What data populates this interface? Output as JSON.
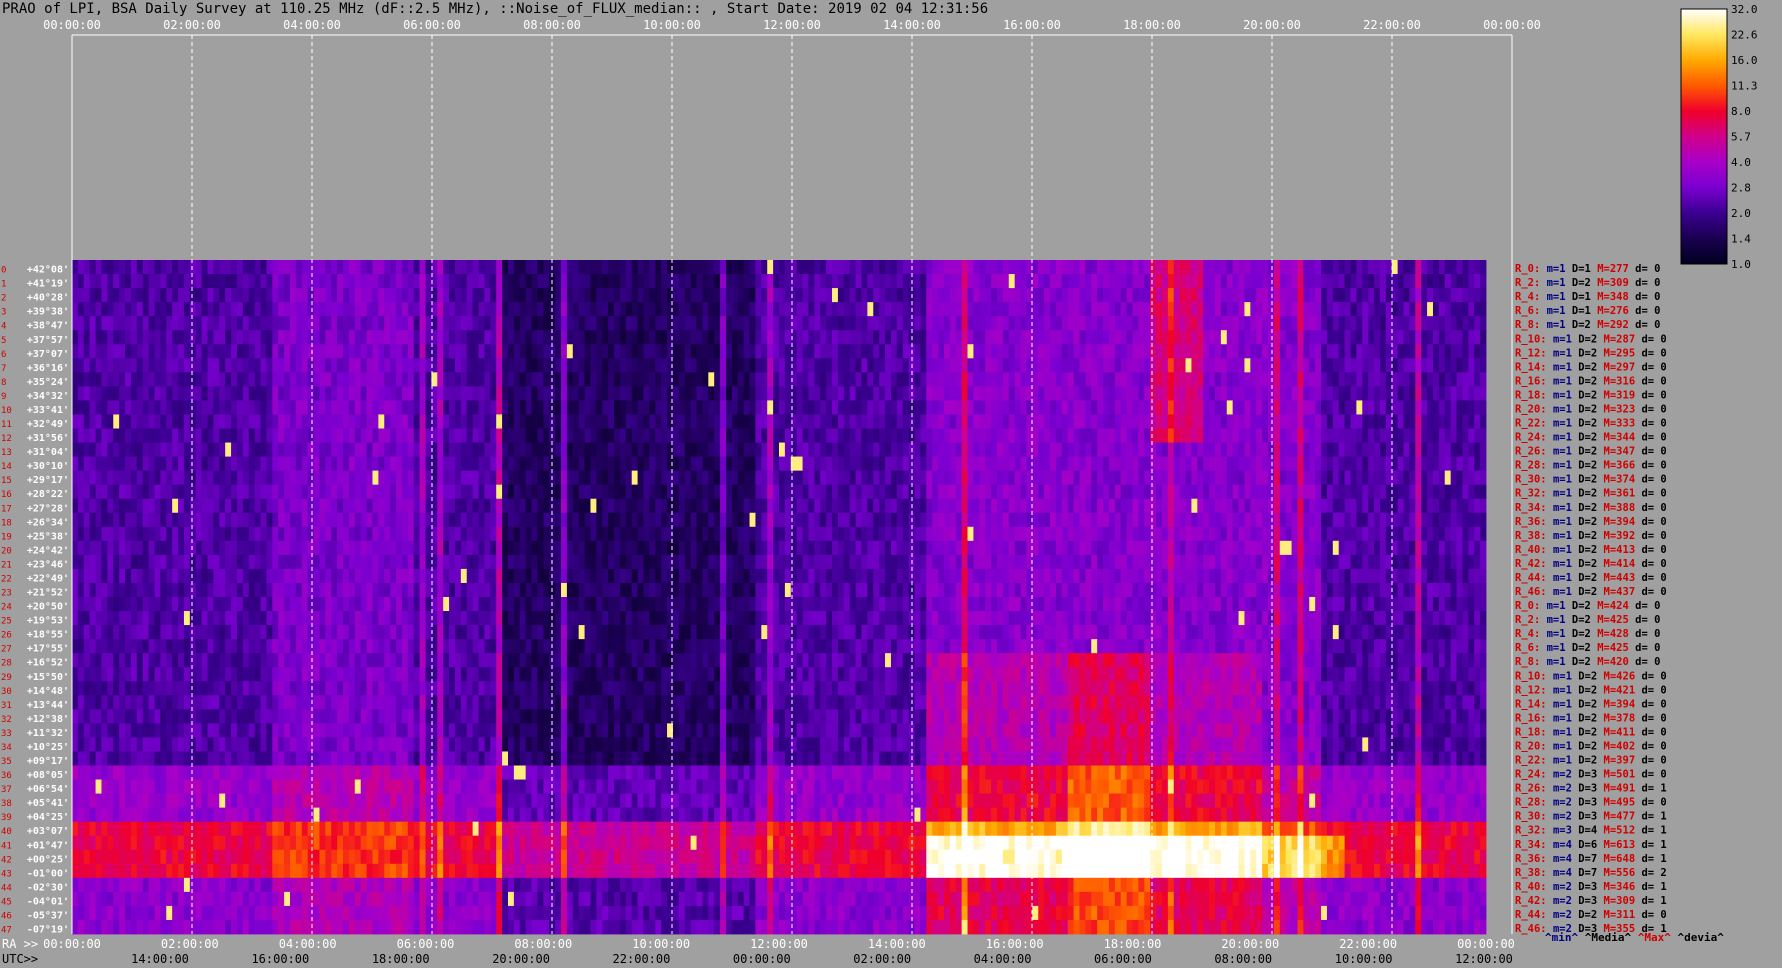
{
  "title": "PRAO of LPI, BSA Daily Survey at 110.25 MHz (dF::2.5 MHz), ::Noise_of_FLUX_median:: , Start Date: 2019 02 04 12:31:56",
  "colors": {
    "background": "#a0a0a0",
    "grid": "#ffffff",
    "stat_r": "#d00000",
    "stat_m": "#000080"
  },
  "chart_data": {
    "type": "heatmap",
    "title": "PRAO of LPI, BSA Daily Survey at 110.25 MHz (dF::2.5 MHz), ::Noise_of_FLUX_median:: , Start Date: 2019 02 04 12:31:56",
    "x_top_ticks": [
      "00:00:00",
      "02:00:00",
      "04:00:00",
      "06:00:00",
      "08:00:00",
      "10:00:00",
      "12:00:00",
      "14:00:00",
      "16:00:00",
      "18:00:00",
      "20:00:00",
      "22:00:00",
      "00:00:00"
    ],
    "x_bottom_prefix": "RA >>",
    "x_bottom_ticks": [
      "00:00:00",
      "02:00:00",
      "04:00:00",
      "06:00:00",
      "08:00:00",
      "10:00:00",
      "12:00:00",
      "14:00:00",
      "16:00:00",
      "18:00:00",
      "20:00:00",
      "22:00:00",
      "00:00:00"
    ],
    "x_utc_prefix": "UTC>>",
    "x_utc_ticks": [
      "14:00:00",
      "16:00:00",
      "18:00:00",
      "20:00:00",
      "22:00:00",
      "00:00:00",
      "02:00:00",
      "04:00:00",
      "06:00:00",
      "08:00:00",
      "10:00:00",
      "12:00:00"
    ],
    "y_labels": [
      "+42°08'",
      "+41°19'",
      "+40°28'",
      "+39°38'",
      "+38°47'",
      "+37°57'",
      "+37°07'",
      "+36°16'",
      "+35°24'",
      "+34°32'",
      "+33°41'",
      "+32°49'",
      "+31°56'",
      "+31°04'",
      "+30°10'",
      "+29°17'",
      "+28°22'",
      "+27°28'",
      "+26°34'",
      "+25°38'",
      "+24°42'",
      "+23°46'",
      "+22°49'",
      "+21°52'",
      "+20°50'",
      "+19°53'",
      "+18°55'",
      "+17°55'",
      "+16°52'",
      "+15°50'",
      "+14°48'",
      "+13°44'",
      "+12°38'",
      "+11°32'",
      "+10°25'",
      "+09°17'",
      "+08°05'",
      "+06°54'",
      "+05°41'",
      "+04°25'",
      "+03°07'",
      "+01°47'",
      "+00°25'",
      "-01°00'",
      "-02°30'",
      "-04°01'",
      "-05°37'",
      "-07°19'"
    ],
    "colorbar": {
      "labels": [
        "32.0",
        "22.6",
        "16.0",
        "11.3",
        "8.0",
        "5.7",
        "4.0",
        "2.8",
        "2.0",
        "1.4",
        "1.0"
      ],
      "scale": "log",
      "range": [
        1.0,
        32.0
      ]
    },
    "row_stats": [
      {
        "r": "R_0:",
        "m": "m=1",
        "D": "D=1",
        "M": "M=277",
        "d": "d= 0"
      },
      {
        "r": "R_2:",
        "m": "m=1",
        "D": "D=2",
        "M": "M=309",
        "d": "d= 0"
      },
      {
        "r": "R_4:",
        "m": "m=1",
        "D": "D=1",
        "M": "M=348",
        "d": "d= 0"
      },
      {
        "r": "R_6:",
        "m": "m=1",
        "D": "D=1",
        "M": "M=276",
        "d": "d= 0"
      },
      {
        "r": "R_8:",
        "m": "m=1",
        "D": "D=2",
        "M": "M=292",
        "d": "d= 0"
      },
      {
        "r": "R_10:",
        "m": "m=1",
        "D": "D=2",
        "M": "M=287",
        "d": "d= 0"
      },
      {
        "r": "R_12:",
        "m": "m=1",
        "D": "D=2",
        "M": "M=295",
        "d": "d= 0"
      },
      {
        "r": "R_14:",
        "m": "m=1",
        "D": "D=2",
        "M": "M=297",
        "d": "d= 0"
      },
      {
        "r": "R_16:",
        "m": "m=1",
        "D": "D=2",
        "M": "M=316",
        "d": "d= 0"
      },
      {
        "r": "R_18:",
        "m": "m=1",
        "D": "D=2",
        "M": "M=319",
        "d": "d= 0"
      },
      {
        "r": "R_20:",
        "m": "m=1",
        "D": "D=2",
        "M": "M=323",
        "d": "d= 0"
      },
      {
        "r": "R_22:",
        "m": "m=1",
        "D": "D=2",
        "M": "M=333",
        "d": "d= 0"
      },
      {
        "r": "R_24:",
        "m": "m=1",
        "D": "D=2",
        "M": "M=344",
        "d": "d= 0"
      },
      {
        "r": "R_26:",
        "m": "m=1",
        "D": "D=2",
        "M": "M=347",
        "d": "d= 0"
      },
      {
        "r": "R_28:",
        "m": "m=1",
        "D": "D=2",
        "M": "M=366",
        "d": "d= 0"
      },
      {
        "r": "R_30:",
        "m": "m=1",
        "D": "D=2",
        "M": "M=374",
        "d": "d= 0"
      },
      {
        "r": "R_32:",
        "m": "m=1",
        "D": "D=2",
        "M": "M=361",
        "d": "d= 0"
      },
      {
        "r": "R_34:",
        "m": "m=1",
        "D": "D=2",
        "M": "M=388",
        "d": "d= 0"
      },
      {
        "r": "R_36:",
        "m": "m=1",
        "D": "D=2",
        "M": "M=394",
        "d": "d= 0"
      },
      {
        "r": "R_38:",
        "m": "m=1",
        "D": "D=2",
        "M": "M=392",
        "d": "d= 0"
      },
      {
        "r": "R_40:",
        "m": "m=1",
        "D": "D=2",
        "M": "M=413",
        "d": "d= 0"
      },
      {
        "r": "R_42:",
        "m": "m=1",
        "D": "D=2",
        "M": "M=414",
        "d": "d= 0"
      },
      {
        "r": "R_44:",
        "m": "m=1",
        "D": "D=2",
        "M": "M=443",
        "d": "d= 0"
      },
      {
        "r": "R_46:",
        "m": "m=1",
        "D": "D=2",
        "M": "M=437",
        "d": "d= 0"
      },
      {
        "r": "R_0:",
        "m": "m=1",
        "D": "D=2",
        "M": "M=424",
        "d": "d= 0"
      },
      {
        "r": "R_2:",
        "m": "m=1",
        "D": "D=2",
        "M": "M=425",
        "d": "d= 0"
      },
      {
        "r": "R_4:",
        "m": "m=1",
        "D": "D=2",
        "M": "M=428",
        "d": "d= 0"
      },
      {
        "r": "R_6:",
        "m": "m=1",
        "D": "D=2",
        "M": "M=425",
        "d": "d= 0"
      },
      {
        "r": "R_8:",
        "m": "m=1",
        "D": "D=2",
        "M": "M=420",
        "d": "d= 0"
      },
      {
        "r": "R_10:",
        "m": "m=1",
        "D": "D=2",
        "M": "M=426",
        "d": "d= 0"
      },
      {
        "r": "R_12:",
        "m": "m=1",
        "D": "D=2",
        "M": "M=421",
        "d": "d= 0"
      },
      {
        "r": "R_14:",
        "m": "m=1",
        "D": "D=2",
        "M": "M=394",
        "d": "d= 0"
      },
      {
        "r": "R_16:",
        "m": "m=1",
        "D": "D=2",
        "M": "M=378",
        "d": "d= 0"
      },
      {
        "r": "R_18:",
        "m": "m=1",
        "D": "D=2",
        "M": "M=411",
        "d": "d= 0"
      },
      {
        "r": "R_20:",
        "m": "m=1",
        "D": "D=2",
        "M": "M=402",
        "d": "d= 0"
      },
      {
        "r": "R_22:",
        "m": "m=1",
        "D": "D=2",
        "M": "M=397",
        "d": "d= 0"
      },
      {
        "r": "R_24:",
        "m": "m=2",
        "D": "D=3",
        "M": "M=501",
        "d": "d= 0"
      },
      {
        "r": "R_26:",
        "m": "m=2",
        "D": "D=3",
        "M": "M=491",
        "d": "d= 1"
      },
      {
        "r": "R_28:",
        "m": "m=2",
        "D": "D=3",
        "M": "M=495",
        "d": "d= 0"
      },
      {
        "r": "R_30:",
        "m": "m=2",
        "D": "D=3",
        "M": "M=477",
        "d": "d= 1"
      },
      {
        "r": "R_32:",
        "m": "m=3",
        "D": "D=4",
        "M": "M=512",
        "d": "d= 1"
      },
      {
        "r": "R_34:",
        "m": "m=4",
        "D": "D=6",
        "M": "M=613",
        "d": "d= 1"
      },
      {
        "r": "R_36:",
        "m": "m=4",
        "D": "D=7",
        "M": "M=648",
        "d": "d= 1"
      },
      {
        "r": "R_38:",
        "m": "m=4",
        "D": "D=7",
        "M": "M=556",
        "d": "d= 2"
      },
      {
        "r": "R_40:",
        "m": "m=2",
        "D": "D=3",
        "M": "M=346",
        "d": "d= 1"
      },
      {
        "r": "R_42:",
        "m": "m=2",
        "D": "D=3",
        "M": "M=309",
        "d": "d= 1"
      },
      {
        "r": "R_44:",
        "m": "m=2",
        "D": "D=2",
        "M": "M=311",
        "d": "d= 0"
      },
      {
        "r": "R_46:",
        "m": "m=2",
        "D": "D=3",
        "M": "M=355",
        "d": "d= 1"
      }
    ],
    "stat_legend": [
      {
        "text": "^min^",
        "color": "#000080"
      },
      {
        "text": "^Media^",
        "color": "#000000"
      },
      {
        "text": "^Max^",
        "color": "#d00000"
      },
      {
        "text": "^devia^",
        "color": "#000000"
      }
    ]
  }
}
